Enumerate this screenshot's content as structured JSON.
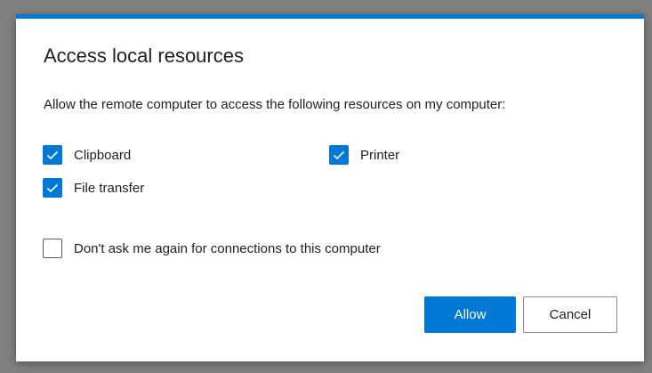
{
  "dialog": {
    "title": "Access local resources",
    "description": "Allow the remote computer to access the following resources on my computer:",
    "accent_color": "#0078d4",
    "resources": {
      "clipboard": {
        "label": "Clipboard",
        "checked": true
      },
      "printer": {
        "label": "Printer",
        "checked": true
      },
      "file_transfer": {
        "label": "File transfer",
        "checked": true
      }
    },
    "dont_ask": {
      "label": "Don't ask me again for connections to this computer",
      "checked": false
    },
    "buttons": {
      "allow_label": "Allow",
      "cancel_label": "Cancel"
    }
  }
}
